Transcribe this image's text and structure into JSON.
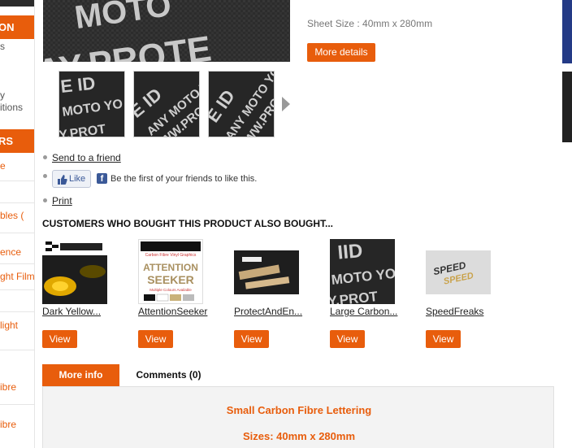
{
  "sidebar": {
    "button_1": "ON",
    "text_1": "s",
    "text_2": "y",
    "text_3": "itions",
    "button_2": "RS",
    "link_1": "e",
    "link_2": "bles (",
    "link_3": "ence",
    "link_4": "ght Film",
    "link_5": "light",
    "link_6": "ibre",
    "link_7": "ibre"
  },
  "product": {
    "sheet_size": "Sheet Size : 40mm x 280mm",
    "more_details": "More details"
  },
  "actions": {
    "send_to_friend": "Send to a friend",
    "like": "Like",
    "facebook_text": "Be the first of your friends to like this.",
    "print": "Print"
  },
  "also_bought": {
    "heading": "CUSTOMERS WHO BOUGHT THIS PRODUCT ALSO BOUGHT...",
    "items": [
      {
        "name": "Dark Yellow...",
        "view": "View"
      },
      {
        "name": "AttentionSeeker",
        "view": "View"
      },
      {
        "name": "ProtectAndEn...",
        "view": "View"
      },
      {
        "name": "Large Carbon...",
        "view": "View"
      },
      {
        "name": "SpeedFreaks",
        "view": "View"
      }
    ]
  },
  "tabs": {
    "more_info": "More info",
    "comments": "Comments (0)"
  },
  "description": {
    "title": "Small Carbon Fibre Lettering",
    "sizes": "Sizes: 40mm x 280mm"
  },
  "image_text": {
    "main": "MOTO YOU\nAY.PROTE",
    "attention_top": "Carbon Fibre Vinyl Graphics",
    "attention_1": "ATTENTION",
    "attention_2": "SEEKER",
    "attention_3": "Multiple Colours Available",
    "speed": "SPEED"
  },
  "colors": {
    "accent": "#e85d0c",
    "facebook": "#3b5998",
    "edge_blue": "#243a86"
  }
}
